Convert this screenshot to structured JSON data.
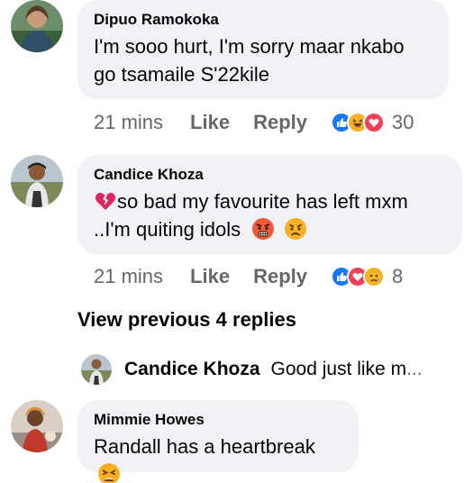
{
  "comments": [
    {
      "author": "Dipuo Ramokoka",
      "text_line1": "I'm sooo hurt, I'm sorry maar nkabo",
      "text_line2": "go tsamaile S'22kile",
      "time": "21 mins",
      "like_label": "Like",
      "reply_label": "Reply",
      "reactions": [
        "like",
        "haha",
        "love"
      ],
      "reaction_count": "30"
    },
    {
      "author": "Candice Khoza",
      "text_line1": "so bad my favourite has left mxm",
      "text_line2": "..I'm quiting idols",
      "time": "21 mins",
      "like_label": "Like",
      "reply_label": "Reply",
      "reactions": [
        "like",
        "love",
        "sad"
      ],
      "reaction_count": "8"
    },
    {
      "author": "Mimmie Howes",
      "text_line1": "Randall has a heartbreak"
    }
  ],
  "view_previous_label": "View previous 4 replies",
  "reply_preview": {
    "author": "Candice Khoza",
    "text": "Good just like m",
    "ellipsis": "..."
  },
  "colors": {
    "bubble": "#f0f2f5",
    "meta_text": "#65676b",
    "like_blue": "#1877f2",
    "love_red": "#f33e58",
    "emoji_yellow": "#f7b125"
  },
  "icons": [
    "broken-heart-icon",
    "angry-face-icon",
    "sad-face-icon",
    "tired-face-icon"
  ]
}
